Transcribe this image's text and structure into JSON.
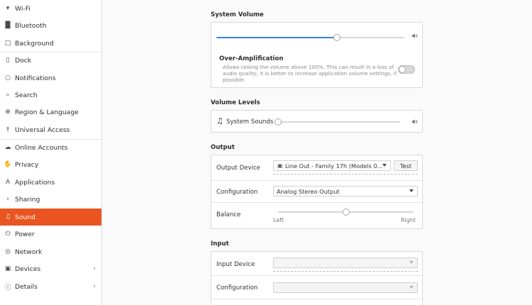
{
  "sidebar": {
    "items": [
      {
        "label": "Wi-Fi",
        "icon": "wifi-icon",
        "glyph": "▾"
      },
      {
        "label": "Bluetooth",
        "icon": "bluetooth-icon",
        "glyph": "█"
      },
      {
        "label": "Background",
        "icon": "background-icon",
        "glyph": "□"
      },
      {
        "label": "Dock",
        "icon": "dock-icon",
        "glyph": "▯"
      },
      {
        "label": "Notifications",
        "icon": "bell-icon",
        "glyph": "○"
      },
      {
        "label": "Search",
        "icon": "search-icon",
        "glyph": "⌕"
      },
      {
        "label": "Region & Language",
        "icon": "globe-icon",
        "glyph": "⊕"
      },
      {
        "label": "Universal Access",
        "icon": "accessibility-icon",
        "glyph": "†"
      },
      {
        "label": "Online Accounts",
        "icon": "cloud-icon",
        "glyph": "☁"
      },
      {
        "label": "Privacy",
        "icon": "hand-icon",
        "glyph": "✋"
      },
      {
        "label": "Applications",
        "icon": "applications-icon",
        "glyph": "A"
      },
      {
        "label": "Sharing",
        "icon": "share-icon",
        "glyph": "‹"
      },
      {
        "label": "Sound",
        "icon": "music-note-icon",
        "glyph": "♫",
        "active": true
      },
      {
        "label": "Power",
        "icon": "power-icon",
        "glyph": "⏻"
      },
      {
        "label": "Network",
        "icon": "network-icon",
        "glyph": "◎"
      },
      {
        "label": "Devices",
        "icon": "devices-icon",
        "glyph": "▣",
        "chevron": "›"
      },
      {
        "label": "Details",
        "icon": "info-icon",
        "glyph": "ⓘ",
        "chevron": "›"
      }
    ]
  },
  "system_volume": {
    "title": "System Volume",
    "level": 0.64,
    "speaker_glyph": "🔊",
    "over_amplification": {
      "title": "Over-Amplification",
      "description_lines": [
        "Allows raising the volume above 100%. This can result in a loss of",
        "audio quality; it is better to increase application volume settings, if",
        "possible."
      ],
      "enabled": false
    }
  },
  "volume_levels": {
    "title": "Volume Levels",
    "system_sounds_label": "System Sounds",
    "note_glyph": "♫",
    "level": 0.0
  },
  "output": {
    "title": "Output",
    "device_label": "Output Device",
    "device_value": "Line Out - Family 17h (Models 0...",
    "test_label": "Test",
    "configuration_label": "Configuration",
    "configuration_value": "Analog Stereo Output",
    "balance_label": "Balance",
    "balance_left": "Left",
    "balance_right": "Right",
    "balance_level": 0.5
  },
  "input": {
    "title": "Input",
    "device_label": "Input Device",
    "configuration_label": "Configuration"
  },
  "colors": {
    "accent": "#e95420",
    "slider_fill": "#3584e4"
  }
}
